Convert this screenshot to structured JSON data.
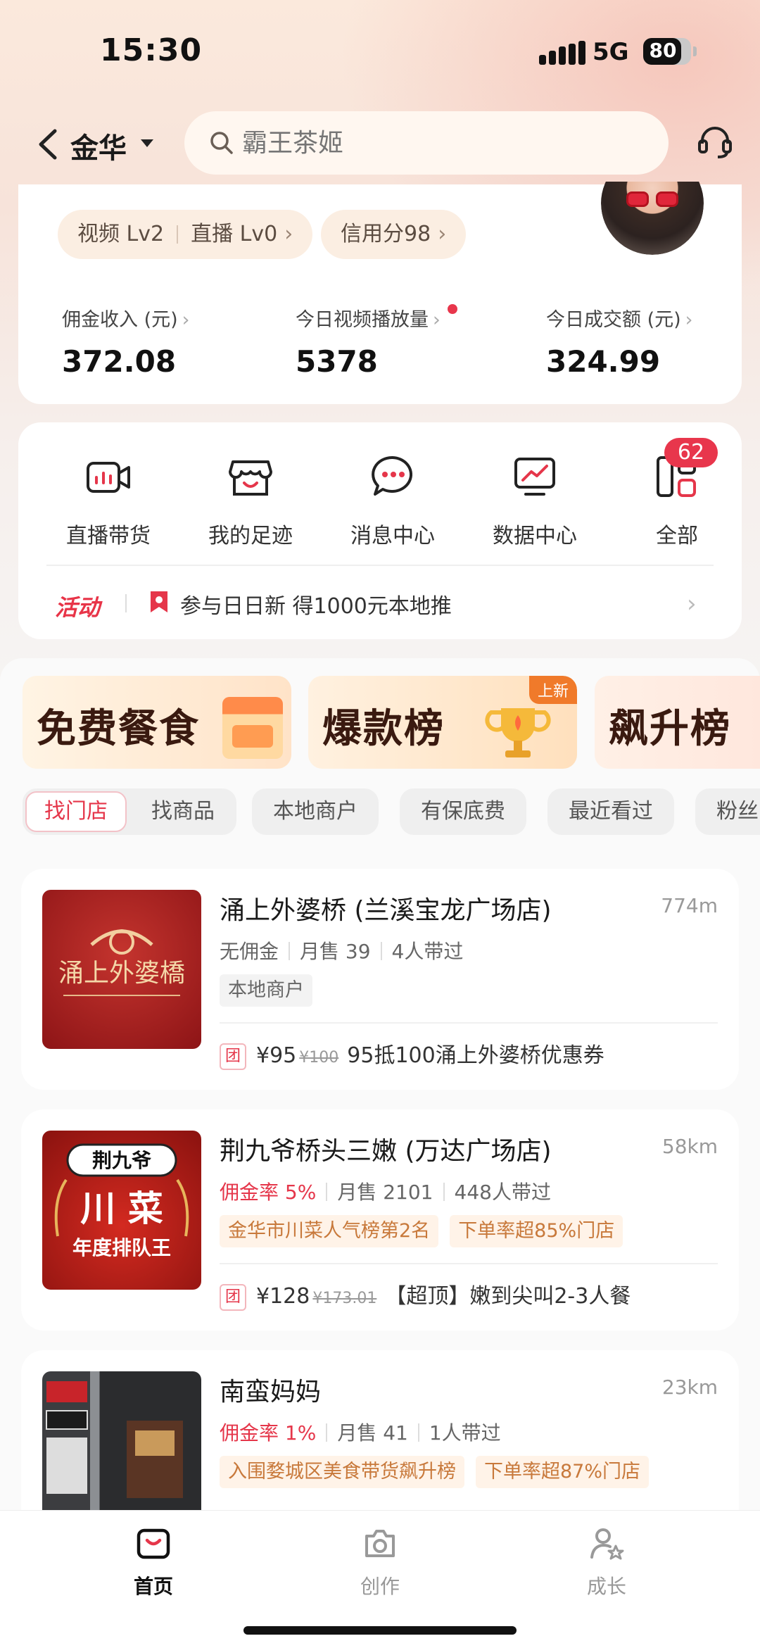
{
  "status_bar": {
    "time": "15:30",
    "network": "5G",
    "battery": "80"
  },
  "header": {
    "city": "金华",
    "search_placeholder": "霸王茶姬"
  },
  "profile": {
    "level_pill": {
      "video": "视频 Lv2",
      "live": "直播 Lv0"
    },
    "credit_pill": "信用分98",
    "stats": [
      {
        "label": "佣金收入 (元)",
        "value": "372.08"
      },
      {
        "label": "今日视频播放量",
        "value": "5378"
      },
      {
        "label": "今日成交额 (元)",
        "value": "324.99"
      }
    ]
  },
  "tools": {
    "items": [
      {
        "label": "直播带货",
        "icon": "live-camera-icon"
      },
      {
        "label": "我的足迹",
        "icon": "store-icon"
      },
      {
        "label": "消息中心",
        "icon": "chat-bubble-icon"
      },
      {
        "label": "数据中心",
        "icon": "chart-monitor-icon"
      },
      {
        "label": "全部",
        "icon": "grid-apps-icon"
      }
    ],
    "all_badge": "62",
    "activity": {
      "tag": "活动",
      "text": "参与日日新  得1000元本地推"
    }
  },
  "banners": [
    {
      "label": "免费餐食"
    },
    {
      "label": "爆款榜",
      "badge": "上新"
    },
    {
      "label": "飙升榜"
    }
  ],
  "filters": {
    "segment": [
      "找门店",
      "找商品"
    ],
    "active": "找门店",
    "chips": [
      "本地商户",
      "有保底费",
      "最近看过",
      "粉丝"
    ]
  },
  "shops": [
    {
      "name": "涌上外婆桥 (兰溪宝龙广场店)",
      "distance": "774m",
      "commission": "无佣金",
      "monthly": "月售 39",
      "promoters": "4人带过",
      "tags": [
        "本地商户"
      ],
      "deal": {
        "tag": "团",
        "price": "¥95",
        "original": "¥100",
        "desc": "95抵100涌上外婆桥优惠券"
      },
      "image_text": "涌上外婆橋"
    },
    {
      "name": "荆九爷桥头三嫩 (万达广场店)",
      "distance": "58km",
      "commission": "佣金率 5%",
      "monthly": "月售 2101",
      "promoters": "448人带过",
      "tags": [
        "金华市川菜人气榜第2名",
        "下单率超85%门店"
      ],
      "deal": {
        "tag": "团",
        "price": "¥128",
        "original": "¥173.01",
        "desc": "【超顶】嫩到尖叫2-3人餐"
      },
      "image_text": {
        "brand": "荆九爷",
        "main": "川 菜",
        "sub": "年度排队王"
      }
    },
    {
      "name": "南蛮妈妈",
      "distance": "23km",
      "commission": "佣金率 1%",
      "monthly": "月售 41",
      "promoters": "1人带过",
      "tags": [
        "入围婺城区美食带货飙升榜",
        "下单率超87%门店"
      ]
    }
  ],
  "bottom_nav": [
    {
      "label": "首页",
      "icon": "home-bag-icon",
      "active": true
    },
    {
      "label": "创作",
      "icon": "camera-icon",
      "active": false
    },
    {
      "label": "成长",
      "icon": "user-star-icon",
      "active": false
    }
  ],
  "colors": {
    "accent": "#e5364a",
    "tag_orange": "#c8793b",
    "background": "#f6f4f3"
  }
}
